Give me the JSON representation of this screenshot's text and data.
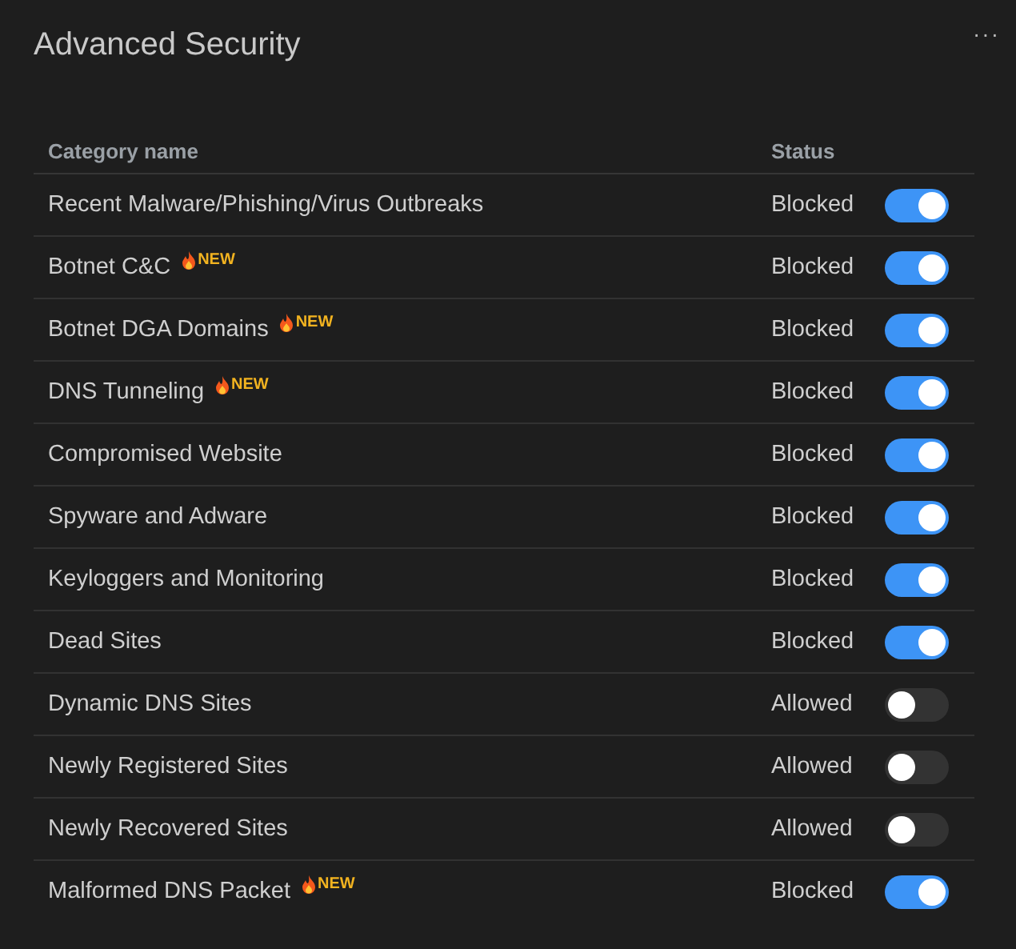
{
  "panel": {
    "title": "Advanced Security",
    "menu": "···"
  },
  "table": {
    "columns": [
      "Category name",
      "Status"
    ],
    "rows": [
      {
        "name": "Recent Malware/Phishing/Virus Outbreaks",
        "status": "Blocked",
        "on": true
      },
      {
        "name": "Botnet C&C",
        "badge": "NEW",
        "status": "Blocked",
        "on": true
      },
      {
        "name": "Botnet DGA Domains",
        "badge": "NEW",
        "status": "Blocked",
        "on": true
      },
      {
        "name": "DNS Tunneling",
        "badge": "NEW",
        "status": "Blocked",
        "on": true
      },
      {
        "name": "Compromised Website",
        "status": "Blocked",
        "on": true
      },
      {
        "name": "Spyware and Adware",
        "status": "Blocked",
        "on": true
      },
      {
        "name": "Keyloggers and Monitoring",
        "status": "Blocked",
        "on": true
      },
      {
        "name": "Dead Sites",
        "status": "Blocked",
        "on": true
      },
      {
        "name": "Dynamic DNS Sites",
        "status": "Allowed",
        "on": false
      },
      {
        "name": "Newly Registered Sites",
        "status": "Allowed",
        "on": false
      },
      {
        "name": "Newly Recovered Sites",
        "status": "Allowed",
        "on": false
      },
      {
        "name": "Malformed DNS Packet",
        "badge": "NEW",
        "status": "Blocked",
        "on": true
      }
    ]
  }
}
